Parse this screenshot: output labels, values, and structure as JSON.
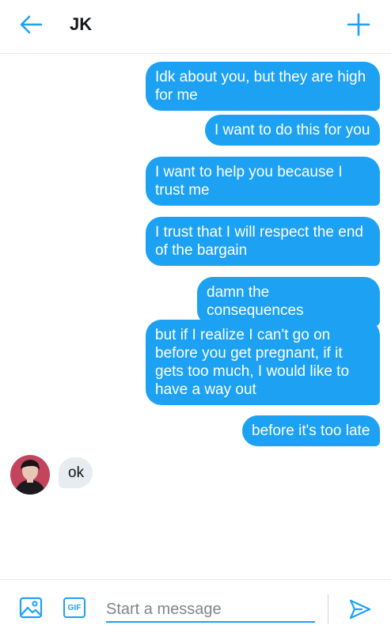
{
  "header": {
    "title": "JK",
    "back_icon": "arrow-left-icon",
    "new_icon": "plus-icon"
  },
  "messages": [
    {
      "sender": "me",
      "text": "Idk about you, but they are high for me"
    },
    {
      "sender": "me",
      "text": "I want to do this for you"
    },
    {
      "sender": "me",
      "text": "I want to help you because I trust me"
    },
    {
      "sender": "me",
      "text": "I trust that I will respect the end of the bargain"
    },
    {
      "sender": "me",
      "text": "damn the consequences"
    },
    {
      "sender": "me",
      "text": "but if I realize I can't go on before you get pregnant, if it gets too much, I would like to have a way out"
    },
    {
      "sender": "me",
      "text": "before it's too late"
    },
    {
      "sender": "them",
      "text": "ok"
    }
  ],
  "composer": {
    "placeholder": "Start a message",
    "gif_label": "GIF",
    "image_icon": "image-icon",
    "send_icon": "send-icon"
  },
  "colors": {
    "accent": "#1da1f2",
    "received_bubble": "#e6ecf0"
  }
}
